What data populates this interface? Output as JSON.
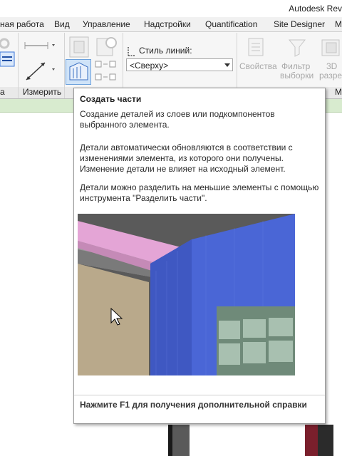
{
  "window": {
    "title": "Autodesk Rev"
  },
  "menu_tabs": [
    "ная работа",
    "Вид",
    "Управление",
    "Надстройки",
    "Quantification",
    "Site Designer",
    "М"
  ],
  "ribbon": {
    "panel_measure": "Измерить",
    "line_style_label": "Стиль линий:",
    "line_style_value": "<Сверху>",
    "properties_label": "Свойства",
    "filter_label_1": "Фильтр",
    "filter_label_2": "выборки",
    "threed_label_1": "3D",
    "threed_label_2": "разре",
    "right_panel_letter": "М"
  },
  "tooltip": {
    "title": "Создать части",
    "p1": "Создание деталей из слоев или подкомпонентов выбранного элемента.",
    "p2": "Детали автоматически обновляются в соответствии с изменениями элемента, из которого они получены. Изменение детали не влияет на исходный элемент.",
    "p3": "Детали можно разделить на меньшие элементы с помощью инструмента \"Разделить части\".",
    "footer": "Нажмите F1 для получения дополнительной справки"
  },
  "colors": {
    "ribbon_bg": "#f6f6f6",
    "status_green": "#d8ebcf",
    "part_blue": "#4a66d6",
    "part_pink": "#e4a5d6"
  }
}
